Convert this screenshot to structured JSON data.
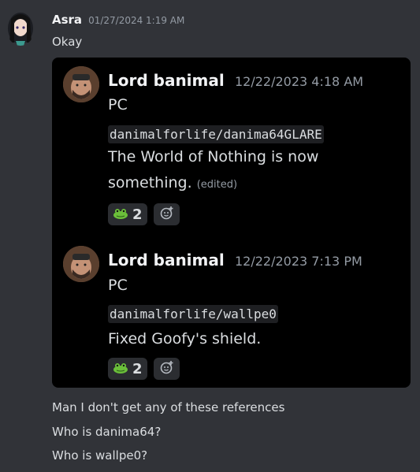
{
  "message": {
    "author": "Asra",
    "timestamp": "01/27/2024 1:19 AM",
    "text": "Okay"
  },
  "embed": {
    "posts": [
      {
        "author": "Lord banimal",
        "timestamp": "12/22/2023 4:18 AM",
        "platform": "PC",
        "repo": "danimalforlife/danima64GLARE",
        "text_line1": "The World of Nothing is now",
        "text_line2": "something.",
        "edited": "(edited)",
        "reaction_count": "2"
      },
      {
        "author": "Lord banimal",
        "timestamp": "12/22/2023 7:13 PM",
        "platform": "PC",
        "repo": "danimalforlife/wallpe0",
        "text_line1": "Fixed Goofy's shield.",
        "reaction_count": "2"
      }
    ]
  },
  "followups": [
    "Man I don't get any of these references",
    "Who is danima64?",
    "Who is wallpe0?"
  ],
  "colors": {
    "background": "#313338",
    "embed_bg": "#000000",
    "reaction_bg": "#2b2d31",
    "muted": "#949ba4"
  },
  "icons": [
    "frog-emoji-icon",
    "add-reaction-icon"
  ]
}
